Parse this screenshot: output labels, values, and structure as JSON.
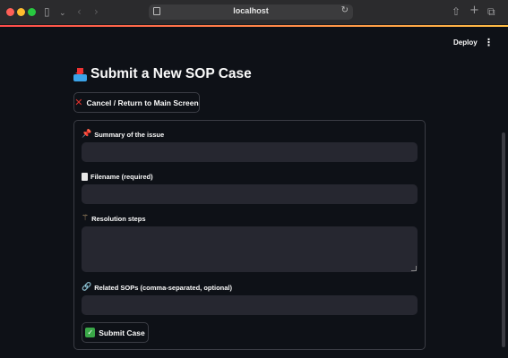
{
  "browser": {
    "url": "localhost"
  },
  "header": {
    "deploy_label": "Deploy",
    "menu_icon": "vertical-ellipsis-icon"
  },
  "page": {
    "title": "Submit a New SOP Case",
    "title_icon": "inbox-tray-icon",
    "cancel_label": "Cancel / Return to Main Screen",
    "submit_label": "Submit Case"
  },
  "form": {
    "fields": [
      {
        "label": "Summary of the issue",
        "icon": "pushpin-icon",
        "value": "",
        "type": "text"
      },
      {
        "label": "Filename (required)",
        "icon": "page-icon",
        "value": "",
        "type": "text"
      },
      {
        "label": "Resolution steps",
        "icon": "magic-wand-icon",
        "value": "",
        "type": "textarea"
      },
      {
        "label": "Related SOPs (comma-separated, optional)",
        "icon": "link-icon",
        "value": "",
        "type": "text"
      }
    ]
  },
  "colors": {
    "background": "#0e1117",
    "input_bg": "#262730",
    "accent_red": "#ff4b4b",
    "accent_yellow": "#ffbd45"
  }
}
